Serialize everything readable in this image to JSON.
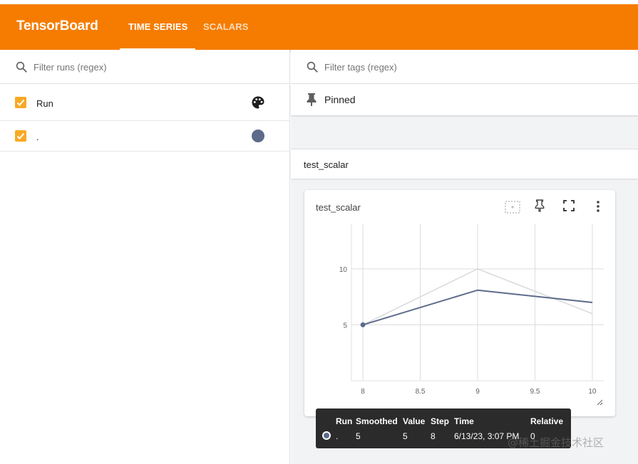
{
  "app": {
    "title": "TensorBoard",
    "accent": "#f57c00"
  },
  "tabs": [
    {
      "label": "TIME SERIES",
      "active": true
    },
    {
      "label": "SCALARS",
      "active": false
    }
  ],
  "runs_panel": {
    "filter_placeholder": "Filter runs (regex)",
    "header": {
      "label": "Run",
      "checked": true,
      "icon": "palette-icon"
    },
    "runs": [
      {
        "label": ".",
        "checked": true,
        "color": "#5c6b8a"
      }
    ]
  },
  "main": {
    "tags_filter_placeholder": "Filter tags (regex)",
    "pinned_label": "Pinned",
    "group_title": "test_scalar",
    "card": {
      "title": "test_scalar",
      "icons": [
        "fit-domain-icon",
        "pin-icon",
        "fullscreen-icon",
        "more-vert-icon"
      ]
    }
  },
  "chart_data": {
    "type": "line",
    "title": "test_scalar",
    "xlabel": "",
    "ylabel": "",
    "x_ticks": [
      "8",
      "8.5",
      "9",
      "9.5",
      "10"
    ],
    "y_ticks": [
      "5",
      "10"
    ],
    "xlim": [
      7.9,
      10.1
    ],
    "ylim": [
      0,
      14
    ],
    "grid": true,
    "series": [
      {
        "x": [
          8,
          9,
          10
        ],
        "y": [
          5,
          10,
          6
        ],
        "color": "#d7d9dc"
      },
      {
        "x": [
          8,
          9,
          10
        ],
        "y": [
          5,
          8.1,
          7
        ],
        "color": "#5c6b8a"
      }
    ],
    "highlight_point": {
      "x": 8,
      "y": 5
    }
  },
  "tooltip": {
    "headers": [
      "Run",
      "Smoothed",
      "Value",
      "Step",
      "Time",
      "Relative"
    ],
    "row": {
      "run": ".",
      "smoothed": "5",
      "value": "5",
      "step": "8",
      "time": "6/13/23, 3:07 PM",
      "relative": "0"
    }
  },
  "watermark": "@稀土掘金技术社区"
}
